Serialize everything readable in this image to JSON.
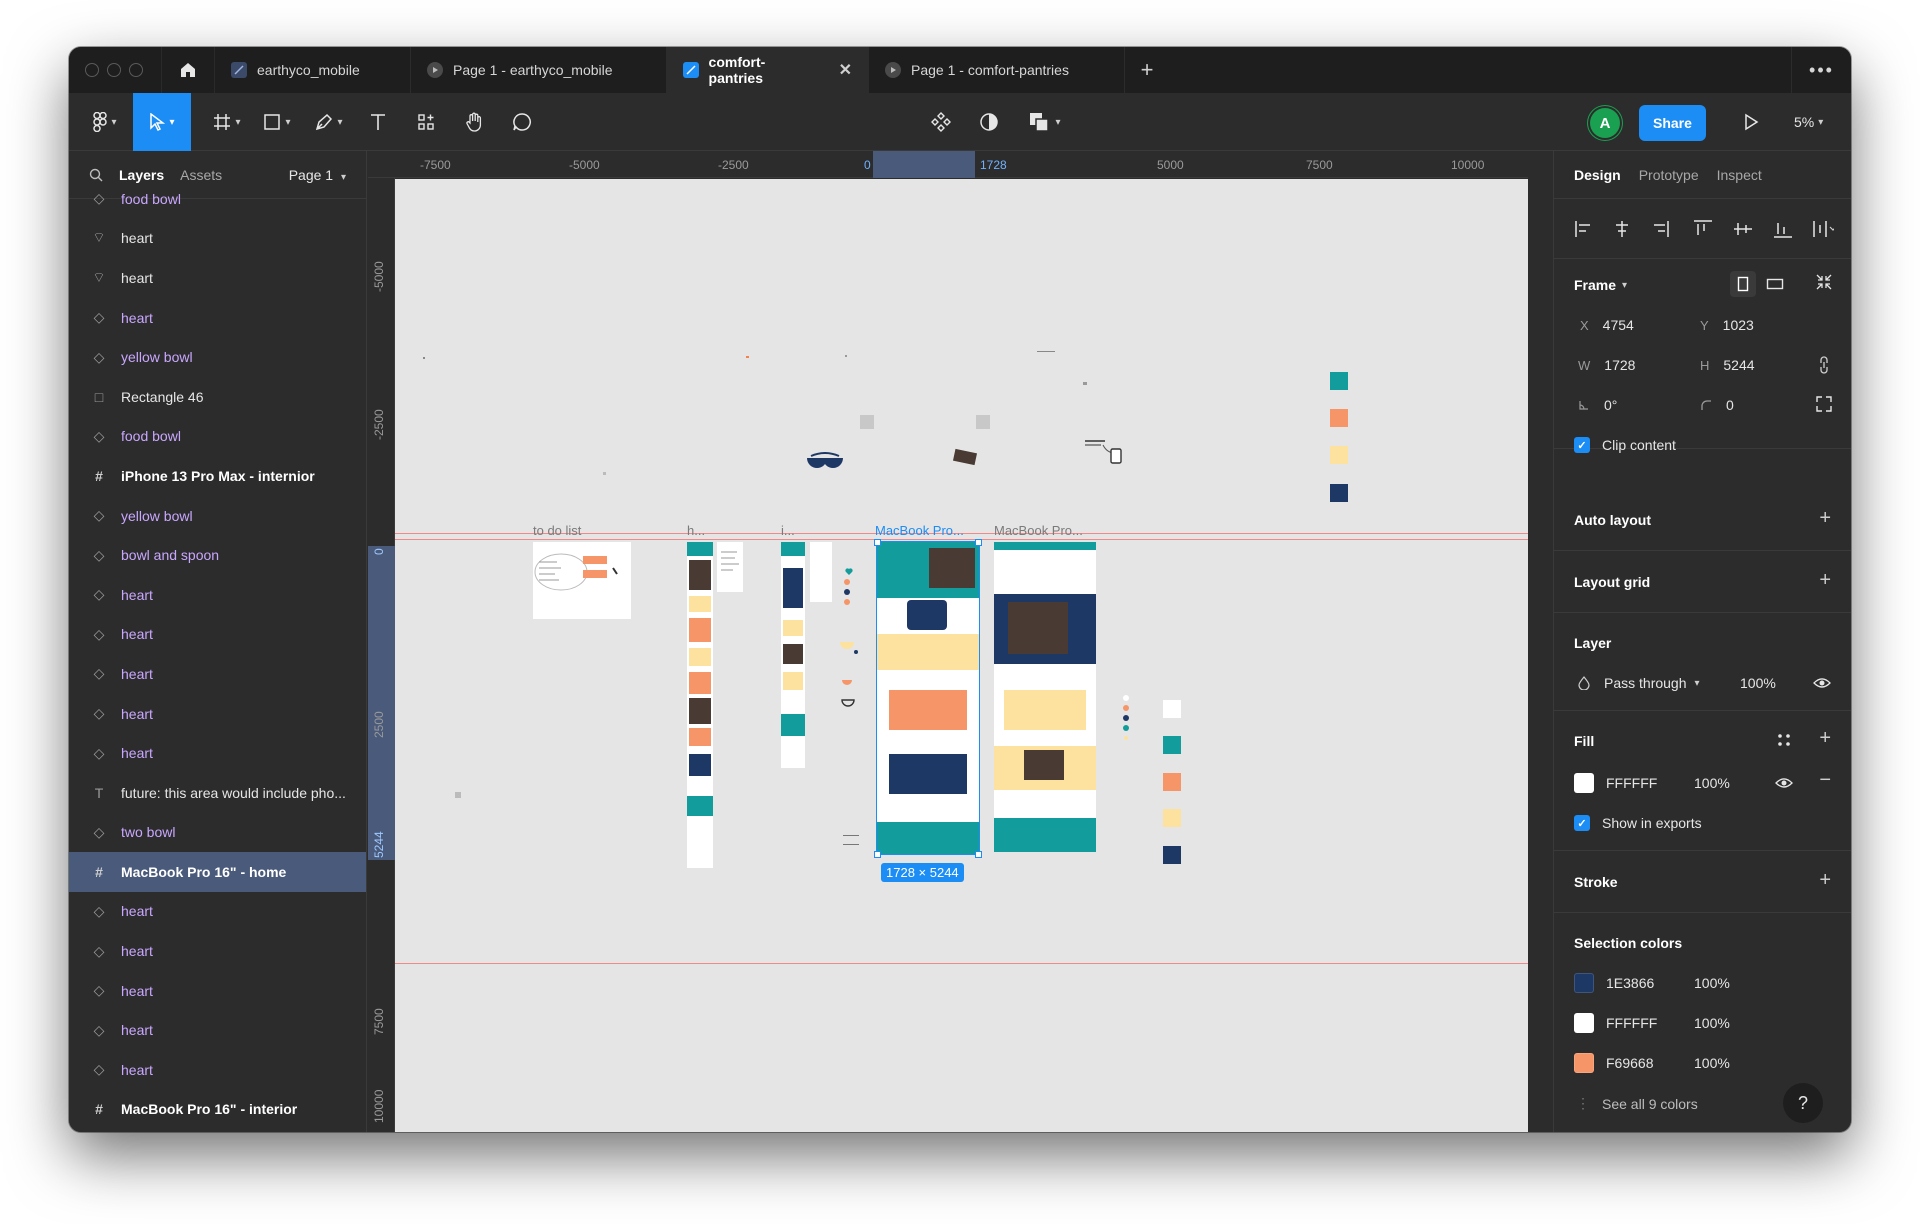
{
  "tabs": [
    {
      "label": "earthyco_mobile",
      "kind": "file",
      "active": false
    },
    {
      "label": "Page 1 - earthyco_mobile",
      "kind": "prototype",
      "active": false
    },
    {
      "label": "comfort-pantries",
      "kind": "file",
      "active": true
    },
    {
      "label": "Page 1 - comfort-pantries",
      "kind": "prototype",
      "active": false
    }
  ],
  "toolbar": {
    "avatar_initial": "A",
    "share_label": "Share",
    "zoom": "5%"
  },
  "left_panel": {
    "tab_layers": "Layers",
    "tab_assets": "Assets",
    "page": "Page 1",
    "layers": [
      {
        "name": "food bowl",
        "kind": "component"
      },
      {
        "name": "heart",
        "kind": "vector"
      },
      {
        "name": "heart",
        "kind": "vector"
      },
      {
        "name": "heart",
        "kind": "component"
      },
      {
        "name": "yellow bowl",
        "kind": "component"
      },
      {
        "name": "Rectangle 46",
        "kind": "rectangle"
      },
      {
        "name": "food bowl",
        "kind": "component"
      },
      {
        "name": "iPhone 13 Pro Max - internior",
        "kind": "frame"
      },
      {
        "name": "yellow bowl",
        "kind": "component"
      },
      {
        "name": "bowl and spoon",
        "kind": "component"
      },
      {
        "name": "heart",
        "kind": "component"
      },
      {
        "name": "heart",
        "kind": "component"
      },
      {
        "name": "heart",
        "kind": "component"
      },
      {
        "name": "heart",
        "kind": "component"
      },
      {
        "name": "heart",
        "kind": "component"
      },
      {
        "name": "future: this area would include pho...",
        "kind": "text"
      },
      {
        "name": "two bowl",
        "kind": "component"
      },
      {
        "name": "MacBook Pro 16\" - home",
        "kind": "frame",
        "selected": true
      },
      {
        "name": "heart",
        "kind": "component"
      },
      {
        "name": "heart",
        "kind": "component"
      },
      {
        "name": "heart",
        "kind": "component"
      },
      {
        "name": "heart",
        "kind": "component"
      },
      {
        "name": "heart",
        "kind": "component"
      },
      {
        "name": "MacBook Pro 16\" - interior",
        "kind": "frame"
      }
    ]
  },
  "rulers": {
    "h_ticks": [
      "-7500",
      "-5000",
      "-2500",
      "0",
      "1728",
      "5000",
      "7500",
      "10000"
    ],
    "v_ticks": [
      "-5000",
      "-2500",
      "0",
      "2500",
      "5244",
      "7500",
      "10000"
    ]
  },
  "canvas": {
    "frame_labels": [
      "to do list",
      "h...",
      "i...",
      "MacBook Pro...",
      "MacBook Pro..."
    ],
    "selection_size": "1728 × 5244",
    "palette_colors": [
      "#139C9C",
      "#F69668",
      "#FCE29E",
      "#1E3866",
      "#FFFFFF"
    ]
  },
  "right_panel": {
    "tabs": [
      "Design",
      "Prototype",
      "Inspect"
    ],
    "frame": {
      "title": "Frame",
      "x_label": "X",
      "x": "4754",
      "y_label": "Y",
      "y": "1023",
      "w_label": "W",
      "w": "1728",
      "h_label": "H",
      "h": "5244",
      "rotation": "0°",
      "radius": "0",
      "clip_label": "Clip content"
    },
    "auto_layout": "Auto layout",
    "layout_grid": "Layout grid",
    "layer": {
      "title": "Layer",
      "blend": "Pass through",
      "opacity": "100%"
    },
    "fill": {
      "title": "Fill",
      "hex": "FFFFFF",
      "opacity": "100%",
      "show_exports": "Show in exports"
    },
    "stroke": "Stroke",
    "selection_colors": {
      "title": "Selection colors",
      "items": [
        {
          "hex": "1E3866",
          "opacity": "100%",
          "color": "#1E3866"
        },
        {
          "hex": "FFFFFF",
          "opacity": "100%",
          "color": "#FFFFFF"
        },
        {
          "hex": "F69668",
          "opacity": "100%",
          "color": "#F69668"
        }
      ],
      "see_all": "See all 9 colors"
    },
    "help": "?"
  }
}
